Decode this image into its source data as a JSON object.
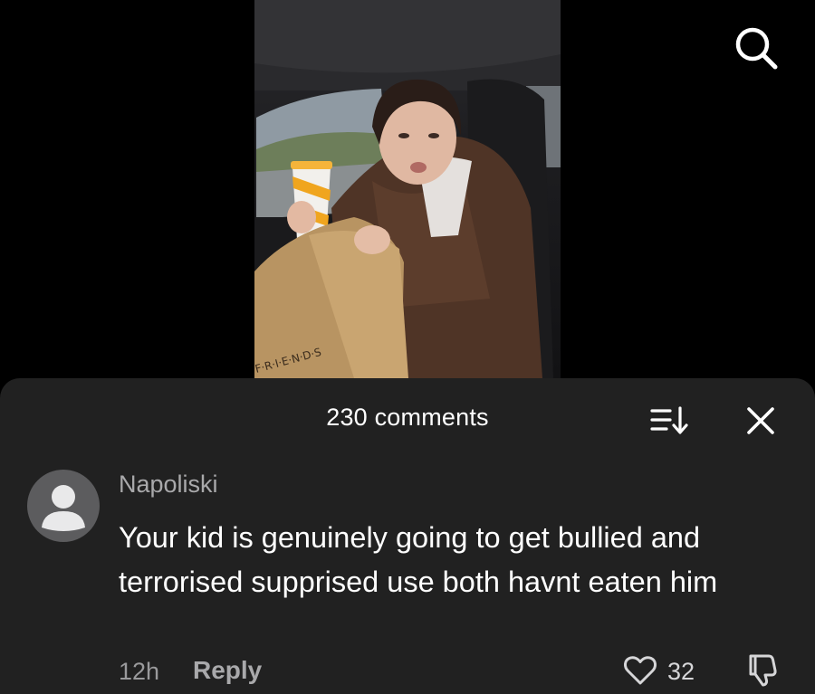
{
  "video": {
    "thumbnail_icon": "video-frame-image",
    "bag_print": "F·R·I·E·N·D·S"
  },
  "header": {
    "search_icon": "search-icon"
  },
  "comments_sheet": {
    "title": "230 comments",
    "sort_icon": "sort-icon",
    "close_icon": "close-icon",
    "background": "#212121"
  },
  "comment": {
    "username": "Napoliski",
    "text": "Your kid is genuinely going to get bullied and terrorised supprised use both havnt eaten him",
    "time": "12h",
    "reply_label": "Reply",
    "likes": "32",
    "avatar_icon": "default-avatar-icon",
    "like_icon": "heart-icon",
    "dislike_icon": "thumbs-down-icon"
  }
}
